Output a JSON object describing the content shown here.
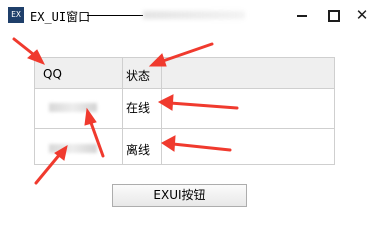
{
  "window": {
    "title": "EX_UI窗口",
    "app_icon_text": "EX"
  },
  "grid": {
    "headers": [
      "QQ",
      "状态"
    ],
    "rows": [
      {
        "qq": "",
        "status": "在线"
      },
      {
        "qq": "",
        "status": "离线"
      }
    ]
  },
  "button": {
    "label": "EXUI按钮"
  },
  "annotation_color": "#f03a2e"
}
